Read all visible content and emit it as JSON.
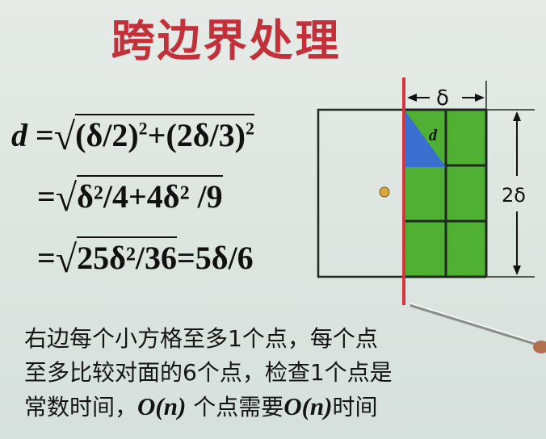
{
  "slide": {
    "title": "跨边界处理",
    "equations": {
      "line1_lhs": "d",
      "line1_rhs_a": "(δ/2)",
      "line1_rhs_b": "+(2δ/3)",
      "exp": "2",
      "line2": "δ²/4+4δ² /9",
      "line3_rad": "25δ²/36",
      "line3_tail": "=5δ/6"
    },
    "diagram": {
      "delta_label": "δ",
      "height_label": "2δ",
      "d_label": "d",
      "colors": {
        "cell_green": "#4fb034",
        "grid_line": "#1d2a1d",
        "boundary_red": "#d7343d",
        "triangle_blue": "#3a6fd0",
        "point": "#d9a640"
      }
    },
    "body_text": {
      "line1": "右边每个小方格至多1个点，每个点",
      "line2": "至多比较对面的6个点，检查1个点是",
      "line3_a": "常数时间，",
      "line3_on1": "O(n)",
      "line3_b": " 个点需要",
      "line3_on2": "O(n)",
      "line3_c": "时间"
    }
  }
}
